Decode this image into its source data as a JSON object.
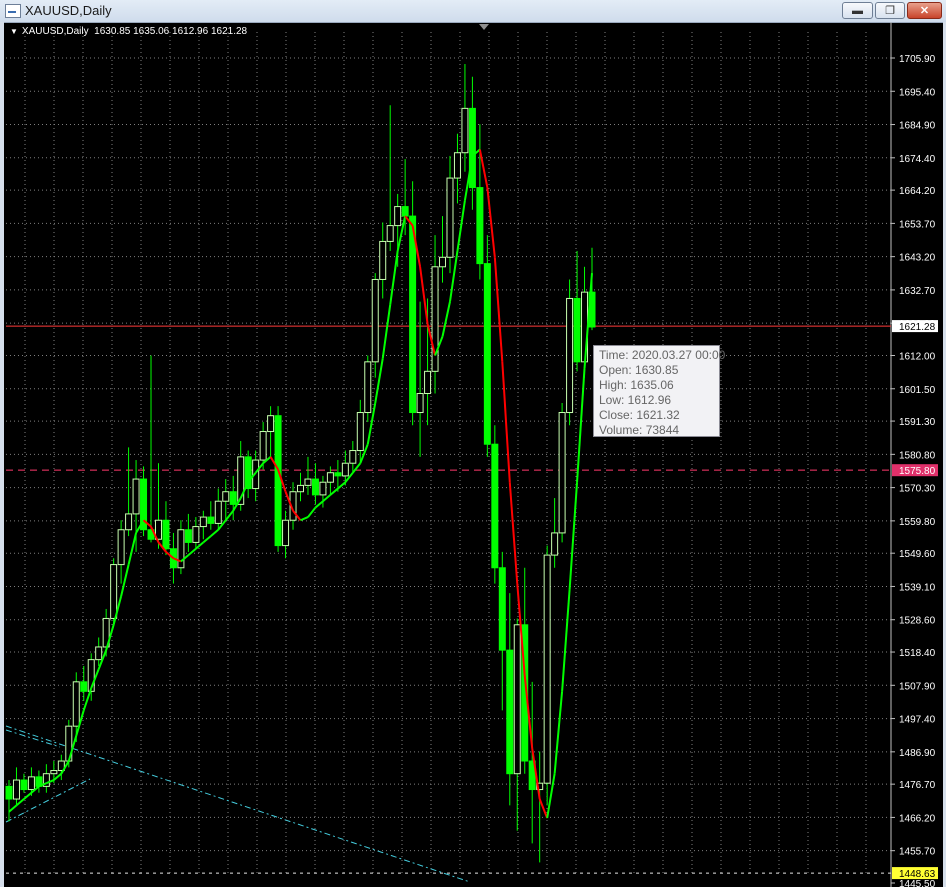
{
  "window": {
    "title": "XAUUSD,Daily",
    "buttons": {
      "minimize": "▬",
      "restore": "❐",
      "close": "✕"
    }
  },
  "chart_header": {
    "symbol": "XAUUSD,Daily",
    "ohlc": "1630.85 1635.06 1612.96 1621.28"
  },
  "colors": {
    "background": "#000000",
    "grid": "#7f7f7f",
    "bull_candle": "#c8ffb0",
    "bear_candle": "#00ff00",
    "ma_up": "#00ff00",
    "ma_down": "#ff0000",
    "bid_line": "#ff3b3b",
    "level_line": "#ff3b6e",
    "trendline": "#44ccdd",
    "axis_text": "#ffffff"
  },
  "price_axis": {
    "labels": [
      "1705.90",
      "1695.40",
      "1684.90",
      "1674.40",
      "1664.20",
      "1653.70",
      "1643.20",
      "1632.70",
      "1622.20",
      "1612.00",
      "1601.50",
      "1591.30",
      "1580.80",
      "1570.30",
      "1559.80",
      "1549.60",
      "1539.10",
      "1528.60",
      "1518.40",
      "1507.90",
      "1497.40",
      "1486.90",
      "1476.70",
      "1466.20",
      "1455.70",
      "1445.50"
    ],
    "current_price": "1621.28",
    "level_label": "1575.80",
    "bottom_label": "1448.63"
  },
  "tooltip": {
    "time": "Time: 2020.03.27 00:00",
    "open": "Open: 1630.85",
    "high": "High: 1635.06",
    "low": "Low:  1612.96",
    "close": "Close: 1621.32",
    "volume": "Volume: 73844"
  },
  "chart_data": {
    "type": "candlestick",
    "symbol": "XAUUSD",
    "timeframe": "Daily",
    "ylim": [
      1445.5,
      1710
    ],
    "candles": [
      [
        1476,
        1478,
        1465,
        1472
      ],
      [
        1472,
        1482,
        1470,
        1478
      ],
      [
        1478,
        1480,
        1474,
        1475
      ],
      [
        1475,
        1482,
        1473,
        1479
      ],
      [
        1479,
        1481,
        1474,
        1476
      ],
      [
        1476,
        1483,
        1474,
        1480
      ],
      [
        1480,
        1484,
        1477,
        1481
      ],
      [
        1481,
        1486,
        1478,
        1484
      ],
      [
        1484,
        1497,
        1482,
        1495
      ],
      [
        1495,
        1512,
        1490,
        1509
      ],
      [
        1509,
        1514,
        1503,
        1506
      ],
      [
        1506,
        1518,
        1503,
        1516
      ],
      [
        1516,
        1523,
        1514,
        1520
      ],
      [
        1520,
        1532,
        1517,
        1529
      ],
      [
        1529,
        1548,
        1527,
        1546
      ],
      [
        1546,
        1560,
        1540,
        1557
      ],
      [
        1557,
        1583,
        1555,
        1562
      ],
      [
        1562,
        1579,
        1550,
        1573
      ],
      [
        1573,
        1577,
        1555,
        1557
      ],
      [
        1557,
        1612,
        1553,
        1554
      ],
      [
        1554,
        1578,
        1551,
        1560
      ],
      [
        1560,
        1566,
        1549,
        1551
      ],
      [
        1551,
        1556,
        1540,
        1545
      ],
      [
        1545,
        1560,
        1543,
        1557
      ],
      [
        1557,
        1562,
        1550,
        1553
      ],
      [
        1553,
        1561,
        1551,
        1558
      ],
      [
        1558,
        1563,
        1554,
        1561
      ],
      [
        1561,
        1566,
        1557,
        1559
      ],
      [
        1559,
        1570,
        1557,
        1566
      ],
      [
        1566,
        1573,
        1560,
        1569
      ],
      [
        1569,
        1574,
        1560,
        1565
      ],
      [
        1565,
        1585,
        1563,
        1580
      ],
      [
        1580,
        1582,
        1567,
        1570
      ],
      [
        1570,
        1582,
        1566,
        1579
      ],
      [
        1579,
        1591,
        1576,
        1588
      ],
      [
        1588,
        1596,
        1580,
        1593
      ],
      [
        1593,
        1596,
        1550,
        1552
      ],
      [
        1552,
        1563,
        1548,
        1560
      ],
      [
        1560,
        1572,
        1557,
        1569
      ],
      [
        1569,
        1575,
        1566,
        1571
      ],
      [
        1571,
        1580,
        1568,
        1573
      ],
      [
        1573,
        1578,
        1565,
        1568
      ],
      [
        1568,
        1574,
        1564,
        1572
      ],
      [
        1572,
        1577,
        1568,
        1575
      ],
      [
        1575,
        1579,
        1569,
        1574
      ],
      [
        1574,
        1582,
        1571,
        1578
      ],
      [
        1578,
        1585,
        1575,
        1582
      ],
      [
        1582,
        1598,
        1578,
        1594
      ],
      [
        1594,
        1612,
        1591,
        1610
      ],
      [
        1610,
        1638,
        1605,
        1636
      ],
      [
        1636,
        1654,
        1630,
        1648
      ],
      [
        1648,
        1691,
        1645,
        1653
      ],
      [
        1653,
        1663,
        1640,
        1659
      ],
      [
        1659,
        1674,
        1650,
        1656
      ],
      [
        1656,
        1667,
        1590,
        1594
      ],
      [
        1594,
        1629,
        1580,
        1600
      ],
      [
        1600,
        1630,
        1590,
        1607
      ],
      [
        1607,
        1650,
        1600,
        1640
      ],
      [
        1640,
        1656,
        1635,
        1643
      ],
      [
        1643,
        1675,
        1638,
        1668
      ],
      [
        1668,
        1682,
        1660,
        1676
      ],
      [
        1676,
        1704,
        1670,
        1690
      ],
      [
        1690,
        1700,
        1658,
        1665
      ],
      [
        1665,
        1685,
        1636,
        1641
      ],
      [
        1641,
        1650,
        1580,
        1584
      ],
      [
        1584,
        1590,
        1540,
        1545
      ],
      [
        1545,
        1550,
        1500,
        1519
      ],
      [
        1519,
        1537,
        1470,
        1480
      ],
      [
        1480,
        1529,
        1462,
        1527
      ],
      [
        1527,
        1545,
        1480,
        1484
      ],
      [
        1484,
        1509,
        1458,
        1475
      ],
      [
        1475,
        1487,
        1452,
        1477
      ],
      [
        1477,
        1552,
        1470,
        1549
      ],
      [
        1549,
        1567,
        1545,
        1556
      ],
      [
        1556,
        1597,
        1553,
        1594
      ],
      [
        1594,
        1636,
        1590,
        1630
      ],
      [
        1630,
        1645,
        1607,
        1610
      ],
      [
        1610,
        1640,
        1605,
        1632
      ],
      [
        1632,
        1646,
        1620,
        1621
      ]
    ],
    "candle_fields": [
      "open",
      "high",
      "low",
      "close"
    ],
    "moving_average": [
      1468,
      1470,
      1472,
      1474,
      1476,
      1477,
      1478,
      1480,
      1484,
      1492,
      1500,
      1507,
      1513,
      1519,
      1527,
      1536,
      1546,
      1556,
      1560,
      1558,
      1553,
      1550,
      1548,
      1547,
      1549,
      1551,
      1553,
      1555,
      1557,
      1560,
      1563,
      1567,
      1572,
      1575,
      1578,
      1580,
      1576,
      1569,
      1563,
      1560,
      1561,
      1564,
      1566,
      1568,
      1570,
      1572,
      1575,
      1578,
      1584,
      1597,
      1611,
      1628,
      1645,
      1656,
      1653,
      1640,
      1622,
      1612,
      1618,
      1629,
      1645,
      1661,
      1675,
      1677,
      1665,
      1643,
      1610,
      1572,
      1540,
      1511,
      1488,
      1472,
      1466,
      1480,
      1506,
      1538,
      1572,
      1608,
      1638
    ],
    "horizontal_lines": [
      {
        "price": 1621.28,
        "style": "solid",
        "role": "bid"
      },
      {
        "price": 1575.8,
        "style": "dashed",
        "role": "level"
      },
      {
        "price": 1448.63,
        "style": "dashed",
        "role": "bottom"
      }
    ],
    "grid": true
  }
}
